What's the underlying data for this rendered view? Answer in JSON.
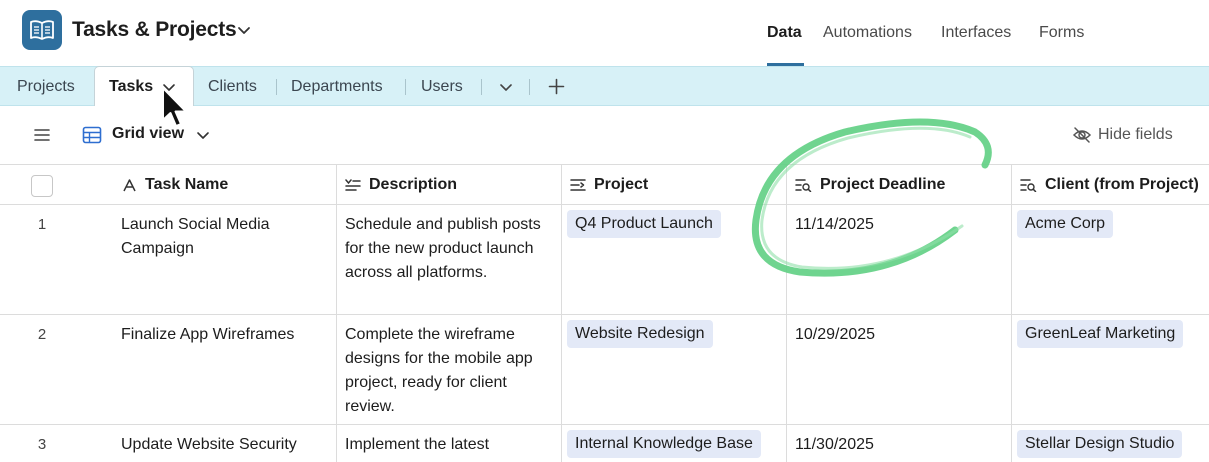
{
  "app": {
    "title": "Tasks & Projects",
    "logo_icon": "book-icon",
    "brand_color": "#2e6f9e"
  },
  "nav": {
    "items": [
      {
        "label": "Data",
        "active": true
      },
      {
        "label": "Automations",
        "active": false
      },
      {
        "label": "Interfaces",
        "active": false
      },
      {
        "label": "Forms",
        "active": false
      }
    ]
  },
  "tables": {
    "tabs": [
      {
        "label": "Projects",
        "active": false
      },
      {
        "label": "Tasks",
        "active": true
      },
      {
        "label": "Clients",
        "active": false
      },
      {
        "label": "Departments",
        "active": false
      },
      {
        "label": "Users",
        "active": false
      }
    ],
    "tab_bar_color": "#d7f1f7"
  },
  "toolbar": {
    "view_name": "Grid view",
    "hide_fields_label": "Hide fields"
  },
  "grid": {
    "columns": [
      {
        "label": "Task Name",
        "icon": "text-a-icon"
      },
      {
        "label": "Description",
        "icon": "long-text-icon"
      },
      {
        "label": "Project",
        "icon": "link-icon"
      },
      {
        "label": "Project Deadline",
        "icon": "lookup-icon"
      },
      {
        "label": "Client (from Project)",
        "icon": "lookup-icon"
      }
    ],
    "rows": [
      {
        "num": "1",
        "task_name": "Launch Social Media Campaign",
        "description": "Schedule and publish posts for the new product launch across all platforms.",
        "project": "Q4 Product Launch",
        "deadline": "11/14/2025",
        "client": "Acme Corp"
      },
      {
        "num": "2",
        "task_name": "Finalize App Wireframes",
        "description": "Complete the wireframe designs for the mobile app project, ready for client review.",
        "project": "Website Redesign",
        "deadline": "10/29/2025",
        "client": "GreenLeaf Marketing"
      },
      {
        "num": "3",
        "task_name": "Update Website Security",
        "description": "Implement the latest",
        "project": "Internal Knowledge Base",
        "deadline": "11/30/2025",
        "client": "Stellar Design Studio"
      }
    ],
    "pill_color": "#e3e9f7",
    "annotation_color": "#5fcf83"
  }
}
